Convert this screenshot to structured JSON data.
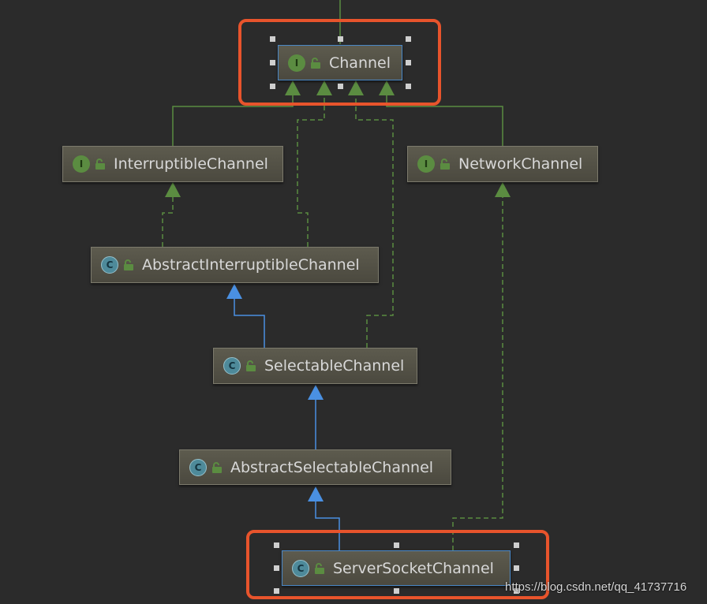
{
  "colors": {
    "background": "#2b2b2b",
    "realization_edge": "#5b8c41",
    "inheritance_edge": "#4a90e2",
    "highlight": "#e8542c",
    "selection": "#4a88c7"
  },
  "nodes": [
    {
      "id": "channel",
      "label": "Channel",
      "kind": "interface",
      "icon": "interface-icon",
      "selected": true,
      "highlighted": true
    },
    {
      "id": "interruptible",
      "label": "InterruptibleChannel",
      "kind": "interface",
      "icon": "interface-icon"
    },
    {
      "id": "network",
      "label": "NetworkChannel",
      "kind": "interface",
      "icon": "interface-icon"
    },
    {
      "id": "abs_interruptible",
      "label": "AbstractInterruptibleChannel",
      "kind": "abstract-class",
      "icon": "abstract-class-icon"
    },
    {
      "id": "selectable",
      "label": "SelectableChannel",
      "kind": "abstract-class",
      "icon": "abstract-class-icon"
    },
    {
      "id": "abs_selectable",
      "label": "AbstractSelectableChannel",
      "kind": "abstract-class",
      "icon": "abstract-class-icon"
    },
    {
      "id": "server_socket",
      "label": "ServerSocketChannel",
      "kind": "abstract-class",
      "icon": "abstract-class-icon",
      "selected": true,
      "highlighted": true
    }
  ],
  "edges": [
    {
      "from": "interruptible",
      "to": "channel",
      "type": "extends-interface",
      "style": "solid-green"
    },
    {
      "from": "abs_interruptible",
      "to": "channel",
      "type": "implements",
      "style": "dashed-green"
    },
    {
      "from": "selectable",
      "to": "channel",
      "type": "implements",
      "style": "dashed-green"
    },
    {
      "from": "network",
      "to": "channel",
      "type": "extends-interface",
      "style": "solid-green"
    },
    {
      "from": "abs_interruptible",
      "to": "interruptible",
      "type": "implements",
      "style": "dashed-green"
    },
    {
      "from": "selectable",
      "to": "abs_interruptible",
      "type": "extends",
      "style": "solid-blue"
    },
    {
      "from": "abs_selectable",
      "to": "selectable",
      "type": "extends",
      "style": "solid-blue"
    },
    {
      "from": "server_socket",
      "to": "abs_selectable",
      "type": "extends",
      "style": "solid-blue"
    },
    {
      "from": "server_socket",
      "to": "network",
      "type": "implements",
      "style": "dashed-green"
    }
  ],
  "watermark": "https://blog.csdn.net/qq_41737716"
}
